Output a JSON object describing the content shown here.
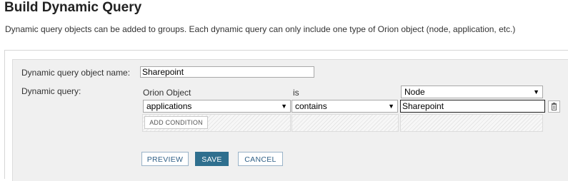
{
  "page": {
    "title": "Build Dynamic Query",
    "description": "Dynamic query objects can be added to groups. Each dynamic query can only include one type of Orion object (node, application, etc.)"
  },
  "form": {
    "name_label": "Dynamic query object name:",
    "name_value": "Sharepoint",
    "query_label": "Dynamic query:",
    "orion_object_label": "Orion Object",
    "is_label": "is",
    "object_type": {
      "selected": "Node"
    },
    "condition": {
      "field": "applications",
      "operator": "contains",
      "value": "Sharepoint"
    },
    "add_condition_label": "ADD CONDITION"
  },
  "buttons": {
    "preview": "PREVIEW",
    "save": "SAVE",
    "cancel": "CANCEL"
  },
  "icons": {
    "dropdown": "caret-down-icon",
    "delete": "trash-icon"
  },
  "colors": {
    "primary": "#2f6f8e",
    "panel_bg": "#f0f0f0"
  }
}
